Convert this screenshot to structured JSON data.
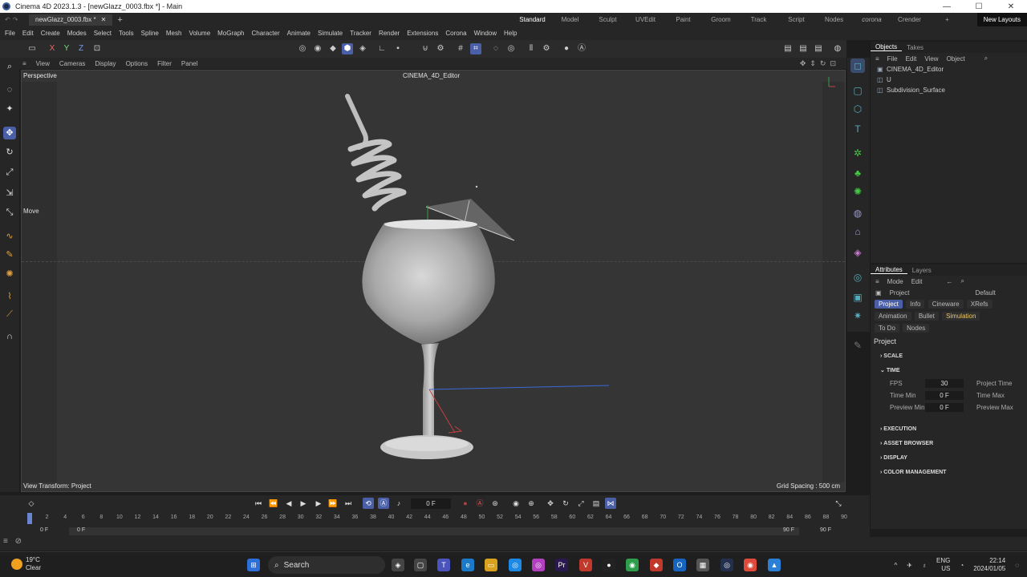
{
  "window": {
    "title": "Cinema 4D 2023.1.3 - [newGlazz_0003.fbx *] - Main"
  },
  "tabs": {
    "file_tab": "newGlazz_0003.fbx *"
  },
  "layouts": [
    "Standard",
    "Model",
    "Sculpt",
    "UVEdit",
    "Paint",
    "Groom",
    "Track",
    "Script",
    "Nodes",
    "corona",
    "Crender"
  ],
  "new_layouts": "New Layouts",
  "menu": [
    "File",
    "Edit",
    "Create",
    "Modes",
    "Select",
    "Tools",
    "Spline",
    "Mesh",
    "Volume",
    "MoGraph",
    "Character",
    "Animate",
    "Simulate",
    "Tracker",
    "Render",
    "Extensions",
    "Corona",
    "Window",
    "Help"
  ],
  "axis_lock": {
    "x": "X",
    "y": "Y",
    "z": "Z"
  },
  "viewport_menu": [
    "View",
    "Cameras",
    "Display",
    "Options",
    "Filter",
    "Panel"
  ],
  "viewport": {
    "label": "Perspective",
    "camera": "CINEMA_4D_Editor",
    "tool_hint": "Move",
    "view_transform": "View Transform: Project",
    "grid_spacing": "Grid Spacing : 500 cm"
  },
  "objects_panel": {
    "tabs": [
      "Objects",
      "Takes"
    ],
    "menu": [
      "File",
      "Edit",
      "View",
      "Object"
    ],
    "items": [
      "CINEMA_4D_Editor",
      "U",
      "Subdivision_Surface"
    ]
  },
  "attributes_panel": {
    "tabs": [
      "Attributes",
      "Layers"
    ],
    "menu": [
      "Mode",
      "Edit"
    ],
    "object": "Project",
    "preset": "Default",
    "chips_row1": [
      "Project",
      "Info",
      "Cineware",
      "XRefs"
    ],
    "chips_row2": [
      "Animation",
      "Bullet",
      "Simulation"
    ],
    "chips_row3": [
      "To Do",
      "Nodes"
    ],
    "heading": "Project",
    "sections": {
      "scale": "SCALE",
      "time": "TIME",
      "execution": "EXECUTION",
      "asset_browser": "ASSET BROWSER",
      "display": "DISPLAY",
      "color_management": "COLOR MANAGEMENT"
    },
    "time_fields": {
      "fps_label": "FPS",
      "fps": "30",
      "time_min_label": "Time Min",
      "time_min": "0 F",
      "preview_min_label": "Preview Min",
      "preview_min": "0 F",
      "project_time_label": "Project Time",
      "time_max_label": "Time Max",
      "preview_max_label": "Preview Max"
    }
  },
  "timeline": {
    "current_frame": "0 F",
    "ticks": [
      "0",
      "2",
      "4",
      "6",
      "8",
      "10",
      "12",
      "14",
      "16",
      "18",
      "20",
      "22",
      "24",
      "26",
      "28",
      "30",
      "32",
      "34",
      "36",
      "38",
      "40",
      "42",
      "44",
      "46",
      "48",
      "50",
      "52",
      "54",
      "56",
      "58",
      "60",
      "62",
      "64",
      "66",
      "68",
      "70",
      "72",
      "74",
      "76",
      "78",
      "80",
      "82",
      "84",
      "86",
      "88",
      "90"
    ],
    "range_start": "0 F",
    "range_start_inner": "0 F",
    "range_end_inner": "90 F",
    "range_end": "90 F"
  },
  "taskbar": {
    "weather_temp": "19°C",
    "weather_desc": "Clear",
    "search": "Search",
    "lang": "ENG",
    "region": "US",
    "time": "22:14",
    "date": "2024/01/05"
  },
  "colors": {
    "accent": "#4a5fa8",
    "viewport_bg": "#353535",
    "panel_bg": "#262626"
  }
}
